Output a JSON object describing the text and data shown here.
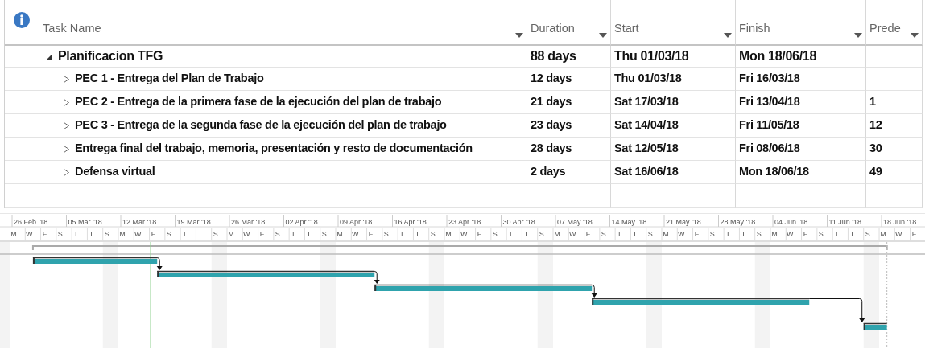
{
  "columns": [
    {
      "label": "Task Name"
    },
    {
      "label": "Duration"
    },
    {
      "label": "Start"
    },
    {
      "label": "Finish"
    },
    {
      "label": "Prede"
    }
  ],
  "tasks": [
    {
      "name": "Planificacion TFG",
      "expanded": true,
      "duration": "88 days",
      "start": "Thu 01/03/18",
      "finish": "Mon 18/06/18",
      "children": [
        {
          "name": "PEC 1 - Entrega del Plan de Trabajo",
          "expanded": false,
          "duration": "12 days",
          "start": "Thu 01/03/18",
          "finish": "Fri 16/03/18"
        },
        {
          "name": "PEC 2 - Entrega de la primera fase de la ejecución del plan de trabajo",
          "expanded": false,
          "duration": "21 days",
          "start": "Sat 17/03/18",
          "finish": "Fri 13/04/18",
          "predecessors": "1"
        },
        {
          "name": "PEC 3 - Entrega de la segunda fase de la ejecución del plan de trabajo",
          "expanded": false,
          "duration": "23 days",
          "start": "Sat 14/04/18",
          "finish": "Fri 11/05/18",
          "predecessors": "12"
        },
        {
          "name": "Entrega final del trabajo, memoria, presentación y resto de documentación",
          "expanded": false,
          "duration": "28 days",
          "start": "Sat 12/05/18",
          "finish": "Fri 08/06/18",
          "predecessors": "30"
        },
        {
          "name": "Defensa virtual",
          "expanded": false,
          "duration": "2 days",
          "start": "Sat 16/06/18",
          "finish": "Mon 18/06/18",
          "predecessors": "49"
        }
      ]
    }
  ],
  "timescale": {
    "weeks": [
      "26 Feb '18",
      "05 Mar '18",
      "12 Mar '18",
      "19 Mar '18",
      "26 Mar '18",
      "02 Apr '18",
      "09 Apr '18",
      "16 Apr '18",
      "23 Apr '18",
      "30 Apr '18",
      "07 May '18",
      "14 May '18",
      "21 May '18",
      "28 May '18",
      "04 Jun '18",
      "11 Jun '18",
      "18 Jun '18"
    ],
    "days": [
      "M",
      "W",
      "F",
      "S",
      "T",
      "T",
      "S",
      "M",
      "W",
      "F",
      "S",
      "T",
      "T",
      "S",
      "M",
      "W",
      "F",
      "S",
      "T",
      "T",
      "S",
      "M",
      "W",
      "F",
      "S",
      "T",
      "T",
      "S",
      "M",
      "W",
      "F",
      "S",
      "T",
      "T",
      "S",
      "M",
      "W",
      "F",
      "S",
      "T",
      "T",
      "S",
      "M",
      "W",
      "F",
      "S",
      "T",
      "T",
      "S",
      "M",
      "W",
      "F",
      "S",
      "T",
      "T",
      "S",
      "M",
      "W",
      "F"
    ]
  }
}
